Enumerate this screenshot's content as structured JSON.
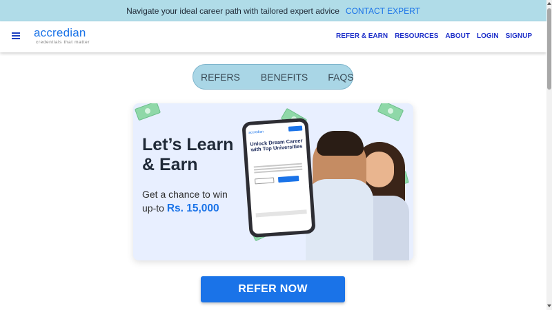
{
  "announcement": {
    "text": "Navigate your ideal career path with tailored expert advice",
    "cta": "CONTACT EXPERT"
  },
  "header": {
    "logo_name": "accredian",
    "logo_tagline": "credentials that matter",
    "nav": [
      "REFER & EARN",
      "RESOURCES",
      "ABOUT",
      "LOGIN",
      "SIGNUP"
    ]
  },
  "tabs": [
    "REFERS",
    "BENEFITS",
    "FAQS"
  ],
  "banner": {
    "headline_line1": "Let’s Learn",
    "headline_line2": "& Earn",
    "subline_line1": "Get a chance to win",
    "subline_prefix": "up-to",
    "amount": "Rs. 15,000",
    "phone_title": "Unlock Dream Career with Top Universities"
  },
  "cta": {
    "label": "REFER NOW"
  },
  "colors": {
    "accent": "#1a73e8",
    "announcement_bg": "#b0dce8",
    "tabs_bg": "#a9d6e6",
    "nav_link": "#1c2ec9"
  }
}
